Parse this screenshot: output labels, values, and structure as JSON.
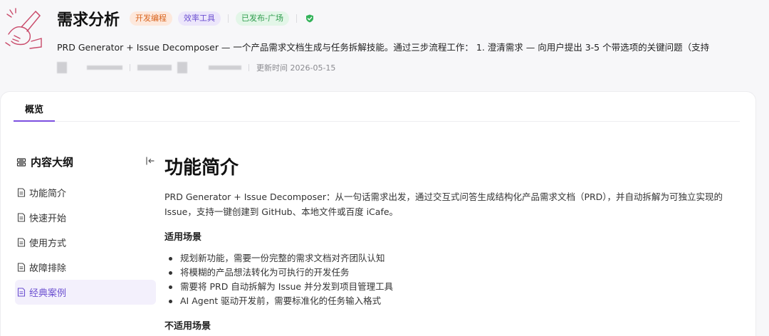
{
  "header": {
    "title": "需求分析",
    "tags": [
      "开发编程",
      "效率工具"
    ],
    "status": "已发布-广场",
    "description": "PRD Generator + Issue Decomposer — 一个产品需求文档生成与任务拆解技能。通过三步流程工作： 1. 澄清需求 — 向用户提出 3-5 个带选项的关键问题（支持",
    "updated": "更新时间 2026-05-15"
  },
  "tabs": [
    {
      "label": "概览"
    }
  ],
  "outline": {
    "title": "内容大纲",
    "items": [
      {
        "label": "功能简介"
      },
      {
        "label": "快速开始"
      },
      {
        "label": "使用方式"
      },
      {
        "label": "故障排除"
      },
      {
        "label": "经典案例"
      }
    ]
  },
  "content": {
    "heading": "功能简介",
    "intro": "PRD Generator + Issue Decomposer：从一句话需求出发，通过交互式问答生成结构化产品需求文档（PRD），并自动拆解为可独立实现的 Issue，支持一键创建到 GitHub、本地文件或百度 iCafe。",
    "scenarios_title": "适用场景",
    "scenarios": [
      "规划新功能，需要一份完整的需求文档对齐团队认知",
      "将模糊的产品想法转化为可执行的开发任务",
      "需要将 PRD 自动拆解为 Issue 并分发到项目管理工具",
      "AI Agent 驱动开发前，需要标准化的任务输入格式"
    ],
    "next_title": "不适用场景"
  },
  "colors": {
    "accent": "#7b4fe0",
    "tag_orange": "#d9641e",
    "tag_purple": "#6b4fd0",
    "status_green": "#2f9c4d"
  }
}
